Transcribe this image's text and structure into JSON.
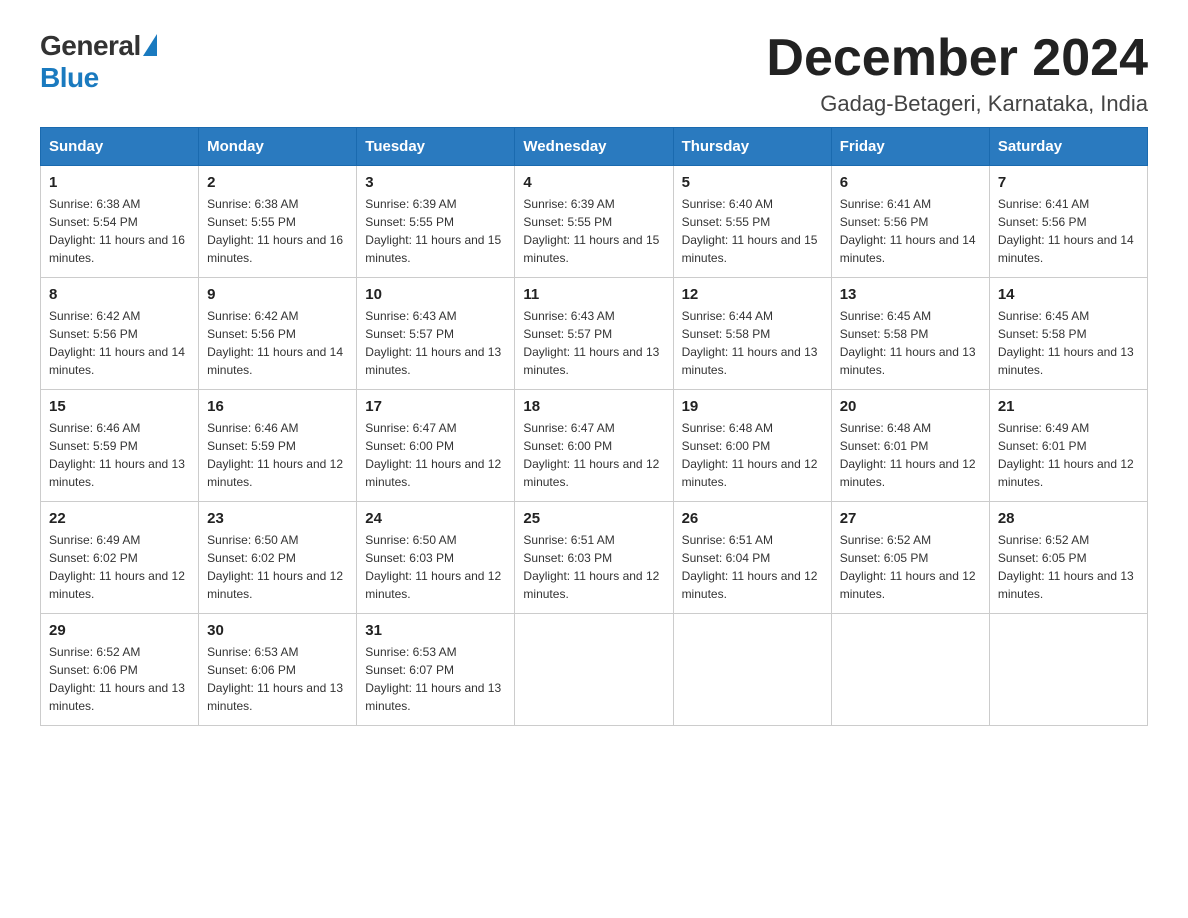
{
  "logo": {
    "general": "General",
    "blue": "Blue"
  },
  "title": "December 2024",
  "subtitle": "Gadag-Betageri, Karnataka, India",
  "weekdays": [
    "Sunday",
    "Monday",
    "Tuesday",
    "Wednesday",
    "Thursday",
    "Friday",
    "Saturday"
  ],
  "weeks": [
    [
      {
        "day": "1",
        "sunrise": "6:38 AM",
        "sunset": "5:54 PM",
        "daylight": "11 hours and 16 minutes."
      },
      {
        "day": "2",
        "sunrise": "6:38 AM",
        "sunset": "5:55 PM",
        "daylight": "11 hours and 16 minutes."
      },
      {
        "day": "3",
        "sunrise": "6:39 AM",
        "sunset": "5:55 PM",
        "daylight": "11 hours and 15 minutes."
      },
      {
        "day": "4",
        "sunrise": "6:39 AM",
        "sunset": "5:55 PM",
        "daylight": "11 hours and 15 minutes."
      },
      {
        "day": "5",
        "sunrise": "6:40 AM",
        "sunset": "5:55 PM",
        "daylight": "11 hours and 15 minutes."
      },
      {
        "day": "6",
        "sunrise": "6:41 AM",
        "sunset": "5:56 PM",
        "daylight": "11 hours and 14 minutes."
      },
      {
        "day": "7",
        "sunrise": "6:41 AM",
        "sunset": "5:56 PM",
        "daylight": "11 hours and 14 minutes."
      }
    ],
    [
      {
        "day": "8",
        "sunrise": "6:42 AM",
        "sunset": "5:56 PM",
        "daylight": "11 hours and 14 minutes."
      },
      {
        "day": "9",
        "sunrise": "6:42 AM",
        "sunset": "5:56 PM",
        "daylight": "11 hours and 14 minutes."
      },
      {
        "day": "10",
        "sunrise": "6:43 AM",
        "sunset": "5:57 PM",
        "daylight": "11 hours and 13 minutes."
      },
      {
        "day": "11",
        "sunrise": "6:43 AM",
        "sunset": "5:57 PM",
        "daylight": "11 hours and 13 minutes."
      },
      {
        "day": "12",
        "sunrise": "6:44 AM",
        "sunset": "5:58 PM",
        "daylight": "11 hours and 13 minutes."
      },
      {
        "day": "13",
        "sunrise": "6:45 AM",
        "sunset": "5:58 PM",
        "daylight": "11 hours and 13 minutes."
      },
      {
        "day": "14",
        "sunrise": "6:45 AM",
        "sunset": "5:58 PM",
        "daylight": "11 hours and 13 minutes."
      }
    ],
    [
      {
        "day": "15",
        "sunrise": "6:46 AM",
        "sunset": "5:59 PM",
        "daylight": "11 hours and 13 minutes."
      },
      {
        "day": "16",
        "sunrise": "6:46 AM",
        "sunset": "5:59 PM",
        "daylight": "11 hours and 12 minutes."
      },
      {
        "day": "17",
        "sunrise": "6:47 AM",
        "sunset": "6:00 PM",
        "daylight": "11 hours and 12 minutes."
      },
      {
        "day": "18",
        "sunrise": "6:47 AM",
        "sunset": "6:00 PM",
        "daylight": "11 hours and 12 minutes."
      },
      {
        "day": "19",
        "sunrise": "6:48 AM",
        "sunset": "6:00 PM",
        "daylight": "11 hours and 12 minutes."
      },
      {
        "day": "20",
        "sunrise": "6:48 AM",
        "sunset": "6:01 PM",
        "daylight": "11 hours and 12 minutes."
      },
      {
        "day": "21",
        "sunrise": "6:49 AM",
        "sunset": "6:01 PM",
        "daylight": "11 hours and 12 minutes."
      }
    ],
    [
      {
        "day": "22",
        "sunrise": "6:49 AM",
        "sunset": "6:02 PM",
        "daylight": "11 hours and 12 minutes."
      },
      {
        "day": "23",
        "sunrise": "6:50 AM",
        "sunset": "6:02 PM",
        "daylight": "11 hours and 12 minutes."
      },
      {
        "day": "24",
        "sunrise": "6:50 AM",
        "sunset": "6:03 PM",
        "daylight": "11 hours and 12 minutes."
      },
      {
        "day": "25",
        "sunrise": "6:51 AM",
        "sunset": "6:03 PM",
        "daylight": "11 hours and 12 minutes."
      },
      {
        "day": "26",
        "sunrise": "6:51 AM",
        "sunset": "6:04 PM",
        "daylight": "11 hours and 12 minutes."
      },
      {
        "day": "27",
        "sunrise": "6:52 AM",
        "sunset": "6:05 PM",
        "daylight": "11 hours and 12 minutes."
      },
      {
        "day": "28",
        "sunrise": "6:52 AM",
        "sunset": "6:05 PM",
        "daylight": "11 hours and 13 minutes."
      }
    ],
    [
      {
        "day": "29",
        "sunrise": "6:52 AM",
        "sunset": "6:06 PM",
        "daylight": "11 hours and 13 minutes."
      },
      {
        "day": "30",
        "sunrise": "6:53 AM",
        "sunset": "6:06 PM",
        "daylight": "11 hours and 13 minutes."
      },
      {
        "day": "31",
        "sunrise": "6:53 AM",
        "sunset": "6:07 PM",
        "daylight": "11 hours and 13 minutes."
      },
      null,
      null,
      null,
      null
    ]
  ]
}
